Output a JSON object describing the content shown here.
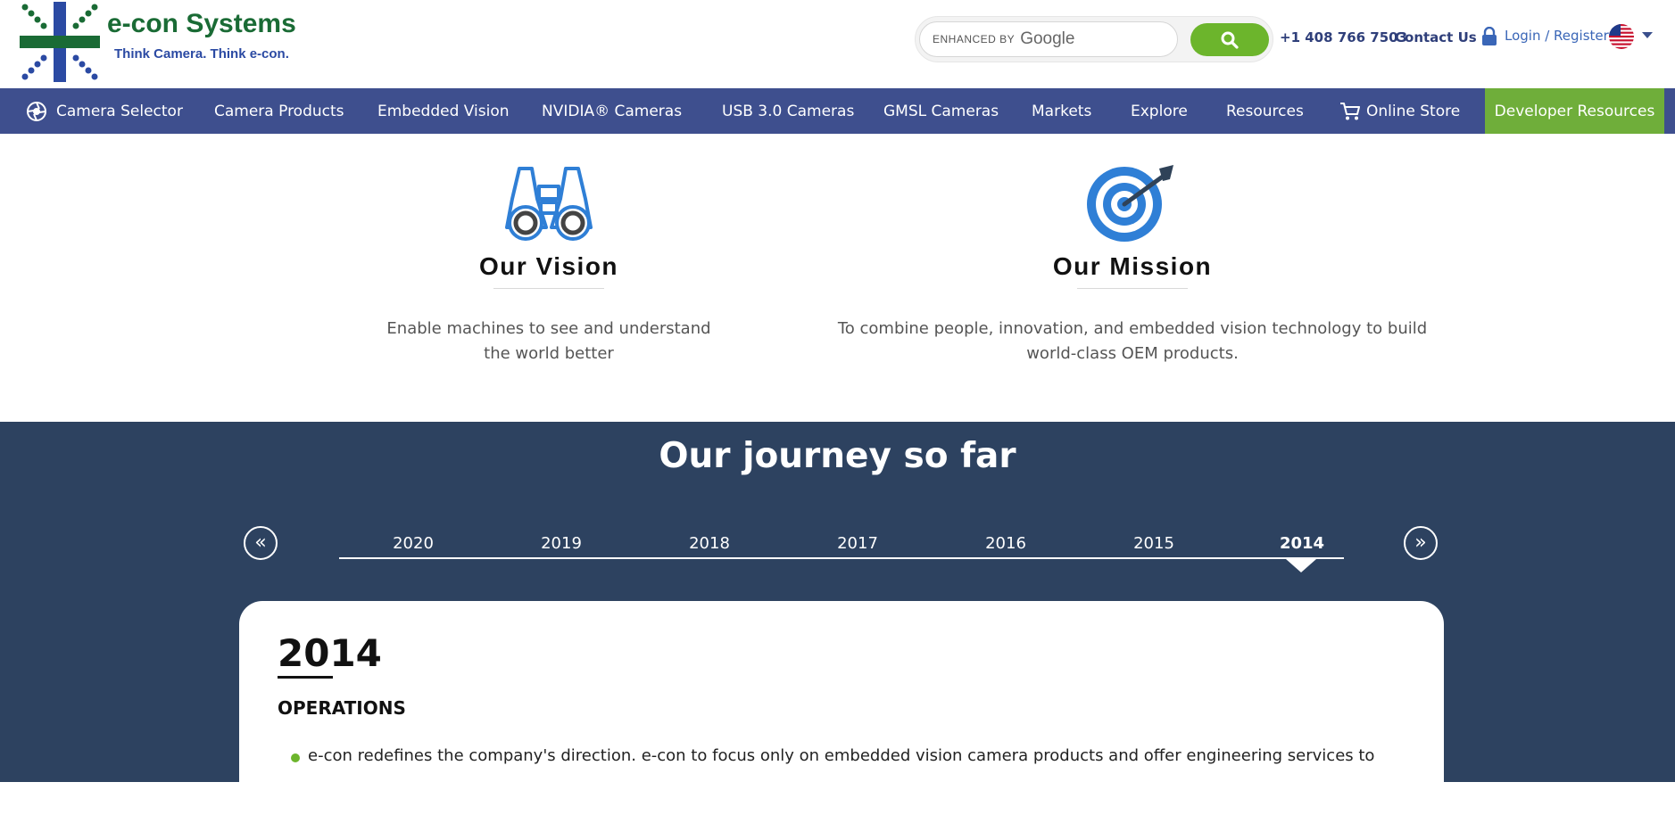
{
  "header": {
    "brand_name": "e-con Systems",
    "tagline": "Think Camera. Think e-con.",
    "search": {
      "enhanced_by": "ENHANCED BY",
      "google_word": "Google"
    },
    "phone": "+1 408 766 7503",
    "contact_label": "Contact Us",
    "login_label": "Login / Register"
  },
  "nav": {
    "items": [
      {
        "label": "Camera Selector",
        "icon": "aperture-icon"
      },
      {
        "label": "Camera Products"
      },
      {
        "label": "Embedded Vision"
      },
      {
        "label": "NVIDIA® Cameras"
      },
      {
        "label": "USB 3.0 Cameras"
      },
      {
        "label": "GMSL Cameras"
      },
      {
        "label": "Markets"
      },
      {
        "label": "Explore"
      },
      {
        "label": "Resources"
      },
      {
        "label": "Online Store",
        "icon": "cart-icon"
      }
    ],
    "developer_resources": "Developer Resources"
  },
  "vision": {
    "icon": "binoculars-icon",
    "title": "Our Vision",
    "line1": "Enable machines to see and understand",
    "line2": "the world better"
  },
  "mission": {
    "icon": "target-icon",
    "title": "Our Mission",
    "line1": "To combine people, innovation, and embedded vision technology to build",
    "line2": "world-class OEM products."
  },
  "journey": {
    "title": "Our journey so far",
    "prev_label": "«",
    "next_label": "»",
    "years": [
      "2020",
      "2019",
      "2018",
      "2017",
      "2016",
      "2015",
      "2014"
    ],
    "active_year": "2014",
    "card": {
      "year": "2014",
      "heading": "OPERATIONS",
      "bullet": "e-con redefines the company's direction. e-con to focus only on embedded vision camera products and offer engineering services to"
    }
  },
  "colors": {
    "brand_green": "#1a6b35",
    "brand_blue": "#2b4aa3",
    "nav_bg": "#3e4f8e",
    "accent_green": "#6cb52c",
    "journey_bg": "#2d4260"
  }
}
